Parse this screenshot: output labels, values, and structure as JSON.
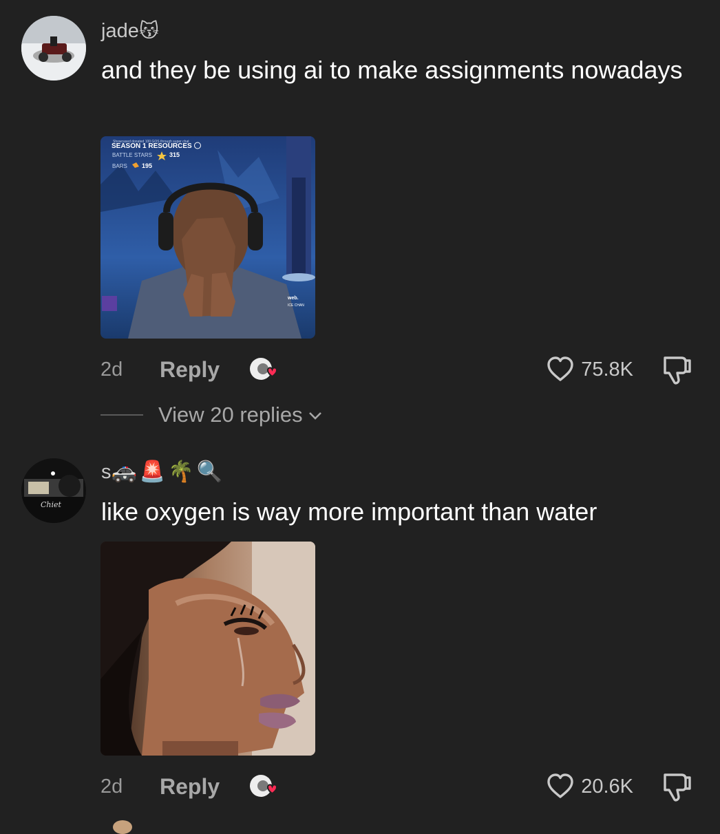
{
  "comments": [
    {
      "username": "jade",
      "username_emoji": "😽",
      "text": "and they be using ai to make assignments nowadays",
      "time": "2d",
      "reply_label": "Reply",
      "likes": "75.8K",
      "view_replies": "View 20 replies",
      "media": {
        "hud_top": "Showcased donated 100 GOS through super chat",
        "hud_title": "SEASON 1 RESOURCES",
        "hud_stars_label": "BATTLE STARS",
        "hud_stars_value": "315",
        "hud_bars_label": "BARS",
        "hud_bars_value": "195",
        "hud_web": "web.",
        "hud_chan": "ICE CHAN"
      }
    },
    {
      "username": "s",
      "username_emoji": "🚓🚨🌴🔍",
      "text": "like oxygen is way more important than water",
      "time": "2d",
      "reply_label": "Reply",
      "likes": "20.6K",
      "avatar_text": "Chiet"
    }
  ],
  "colors": {
    "background": "#212121",
    "muted_text": "#a8a8a8",
    "heart_badge": "#fe2c55"
  },
  "icons": {
    "like": "heart-outline-icon",
    "dislike": "thumbs-down-icon",
    "reaction": "sticker-reaction-icon",
    "expand": "chevron-down-icon"
  }
}
